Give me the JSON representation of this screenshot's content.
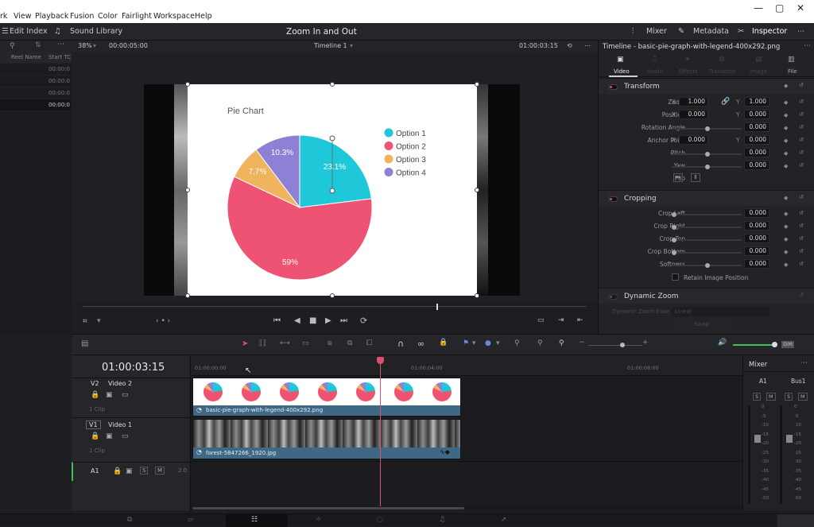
{
  "menu": {
    "items": [
      "rk",
      "View",
      "Playback",
      "Fusion",
      "Color",
      "Fairlight",
      "Workspace",
      "Help"
    ]
  },
  "toolbar": {
    "edit_index": "Edit Index",
    "sound_library": "Sound Library",
    "title": "Zoom In and Out",
    "mixer": "Mixer",
    "metadata": "Metadata",
    "inspector": "Inspector"
  },
  "media": {
    "col_reel": "Reel Name",
    "col_start": "Start TC",
    "rows": [
      "00:00:0",
      "00:00:0",
      "00:00:0",
      "00:00:0"
    ]
  },
  "viewer": {
    "zoom": "38%",
    "timecode_left": "00:00:05:00",
    "timeline_name": "Timeline 1",
    "timecode_right": "01:00:03:15"
  },
  "chart_data": {
    "type": "pie",
    "title": "Pie Chart",
    "categories": [
      "Option 1",
      "Option 2",
      "Option 3",
      "Option 4"
    ],
    "values": [
      23.1,
      59,
      7.7,
      10.3
    ],
    "labels": [
      "23.1%",
      "59%",
      "7.7%",
      "10.3%"
    ],
    "colors": [
      "#1ec8d8",
      "#ef5374",
      "#f0b45f",
      "#8e80d4"
    ],
    "legend": "right"
  },
  "inspector": {
    "header": "Timeline - basic-pie-graph-with-legend-400x292.png",
    "tabs": [
      "Video",
      "Audio",
      "Effects",
      "Transition",
      "Image",
      "File"
    ],
    "transform": {
      "title": "Transform",
      "zoom_label": "Zoom",
      "zoom_x": "1.000",
      "zoom_y": "1.000",
      "position_label": "Position",
      "pos_x": "0.000",
      "pos_y": "0.000",
      "rotation_label": "Rotation Angle",
      "rotation": "0.000",
      "anchor_label": "Anchor Point",
      "anchor_x": "0.000",
      "anchor_y": "0.000",
      "pitch_label": "Pitch",
      "pitch": "0.000",
      "yaw_label": "Yaw",
      "yaw": "0.000",
      "flip_label": "Flip",
      "x": "X",
      "y": "Y"
    },
    "cropping": {
      "title": "Cropping",
      "left_label": "Crop Left",
      "left": "0.000",
      "right_label": "Crop Right",
      "right": "0.000",
      "top_label": "Crop Top",
      "top": "0.000",
      "bottom_label": "Crop Bottom",
      "bottom": "0.000",
      "softness_label": "Softness",
      "softness": "0.000",
      "retain": "Retain Image Position"
    },
    "dynamic_zoom": {
      "title": "Dynamic Zoom",
      "ease_label": "Dynamic Zoom Ease",
      "ease": "Linear",
      "swap": "Swap"
    }
  },
  "timeline": {
    "timecode": "01:00:03:15",
    "ruler": [
      "01:00:00:00",
      "01:00:04:00",
      "01:00:08:00"
    ],
    "v2": {
      "id": "V2",
      "name": "Video 2",
      "clips": "1 Clip",
      "clip_name": "basic-pie-graph-with-legend-400x292.png"
    },
    "v1": {
      "id": "V1",
      "name": "Video 1",
      "clips": "1 Clip",
      "clip_name": "forest-5847266_1920.jpg"
    },
    "a1": {
      "id": "A1",
      "level": "2.0",
      "s": "S",
      "m": "M"
    }
  },
  "mixer": {
    "title": "Mixer",
    "ch1": "A1",
    "ch2": "Bus1",
    "s": "S",
    "m": "M",
    "scale": [
      "0",
      "-5",
      "-10",
      "-15",
      "-20",
      "-25",
      "-30",
      "-35",
      "-40",
      "-45",
      "-50"
    ]
  }
}
